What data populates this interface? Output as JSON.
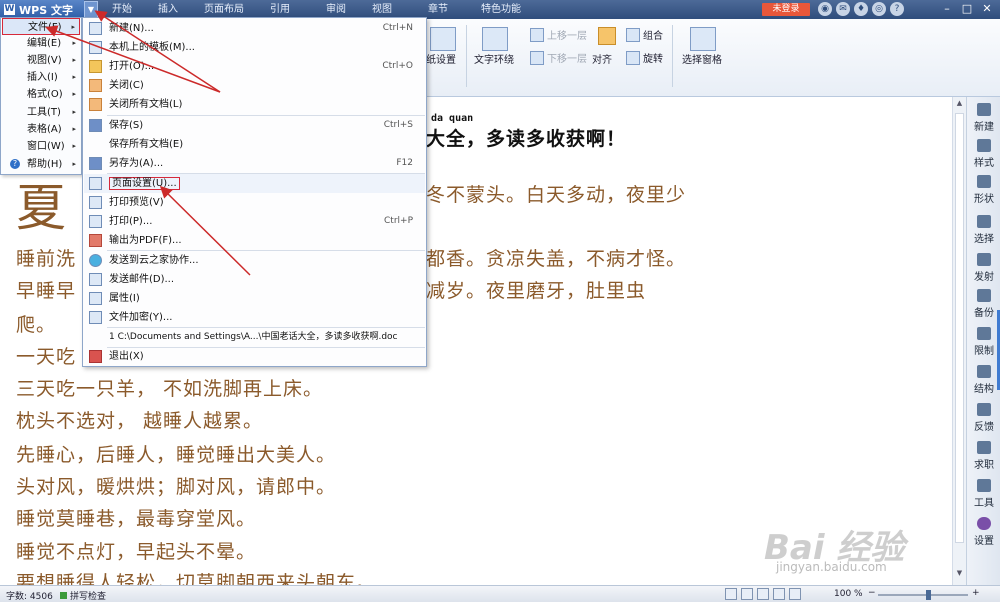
{
  "titlebar": {
    "app_name": "WPS 文字",
    "logo": "W",
    "dropdown_glyph": "▼",
    "tabs": [
      "开始",
      "插入",
      "页面布局",
      "引用",
      "审阅",
      "视图",
      "章节",
      "特色功能"
    ],
    "login_label": "未登录",
    "help_glyph": "?",
    "window_controls": [
      "–",
      "□",
      "✕"
    ]
  },
  "ribbon": {
    "page_setup": "纸设置",
    "text_wrap": "文字环绕",
    "bring_forward": "上移一层",
    "send_backward": "下移一层",
    "align": "对齐",
    "group": "组合",
    "rotate": "旋转",
    "selection_pane": "选择窗格"
  },
  "file_menu": {
    "items": [
      {
        "label": "文件(F)",
        "arrow": "▸"
      },
      {
        "label": "编辑(E)",
        "arrow": "▸"
      },
      {
        "label": "视图(V)",
        "arrow": "▸"
      },
      {
        "label": "插入(I)",
        "arrow": "▸"
      },
      {
        "label": "格式(O)",
        "arrow": "▸"
      },
      {
        "label": "工具(T)",
        "arrow": "▸"
      },
      {
        "label": "表格(A)",
        "arrow": "▸"
      },
      {
        "label": "窗口(W)",
        "arrow": "▸"
      },
      {
        "label": "帮助(H)",
        "arrow": "▸"
      }
    ]
  },
  "submenu": {
    "items": [
      {
        "label": "新建(N)...",
        "shortcut": "Ctrl+N"
      },
      {
        "label": "本机上的模板(M)...",
        "shortcut": ""
      },
      {
        "label": "打开(O)...",
        "shortcut": "Ctrl+O"
      },
      {
        "label": "关闭(C)",
        "shortcut": ""
      },
      {
        "label": "关闭所有文档(L)",
        "shortcut": ""
      },
      {
        "label": "保存(S)",
        "shortcut": "Ctrl+S"
      },
      {
        "label": "保存所有文档(E)",
        "shortcut": ""
      },
      {
        "label": "另存为(A)...",
        "shortcut": "F12"
      },
      {
        "label": "页面设置(U)...",
        "shortcut": ""
      },
      {
        "label": "打印预览(V)",
        "shortcut": ""
      },
      {
        "label": "打印(P)...",
        "shortcut": "Ctrl+P"
      },
      {
        "label": "输出为PDF(F)...",
        "shortcut": ""
      },
      {
        "label": "发送到云之家协作...",
        "shortcut": ""
      },
      {
        "label": "发送邮件(D)...",
        "shortcut": ""
      },
      {
        "label": "属性(I)",
        "shortcut": ""
      },
      {
        "label": "文件加密(Y)...",
        "shortcut": ""
      },
      {
        "label": "1 C:\\Documents and Settings\\A...\\中国老话大全，多读多收获啊.doc",
        "shortcut": ""
      },
      {
        "label": "退出(X)",
        "shortcut": ""
      }
    ]
  },
  "document": {
    "pinyin": "da quan",
    "title_tail": "大全，多读多收获啊！",
    "big_char": "夏",
    "lines": [
      "冬不蒙头。白天多动，夜里少",
      "睡前洗",
      "都香。贪凉失盖，不病才怪。",
      "早睡早",
      "减岁。夜里磨牙，肚里虫",
      "爬。",
      "一天吃",
      "三天吃一只羊，  不如洗脚再上床。",
      "枕头不选对，  越睡人越累。",
      "先睡心，后睡人，睡觉睡出大美人。",
      "头对风，暖烘烘；脚对风，请郎中。",
      "睡觉莫睡巷，最毒穿堂风。",
      "睡觉不点灯，早起头不晕。",
      "要想睡得人轻松，切莫脚朝西来头朝东。"
    ]
  },
  "sidebar": {
    "items": [
      "新建",
      "样式",
      "形状",
      "选择",
      "发射",
      "备份",
      "限制",
      "结构",
      "反馈",
      "求职",
      "工具",
      "设置"
    ]
  },
  "statusbar": {
    "word_count": "字数: 4506",
    "spell_check": "拼写检查",
    "zoom": "100 %",
    "zoom_minus": "−",
    "zoom_plus": "+"
  },
  "scrollbar": {
    "up": "▲",
    "down": "▼"
  },
  "watermark": {
    "brand": "Bai 经验",
    "site": "jingyan.baidu.com"
  },
  "colors": {
    "accent": "#2d5da6",
    "highlight": "#d6293a",
    "doc_text": "#8b5a2b"
  }
}
